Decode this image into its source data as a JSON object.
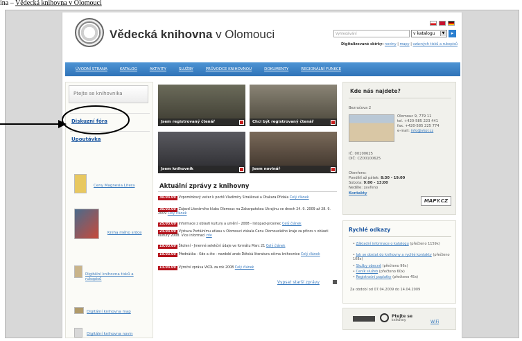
{
  "caption": {
    "text": "ina – Vědecká knihovna v Olomouci",
    "underlined_part": "Vědecká knihovna v Olomouci",
    "prefix": "ina – "
  },
  "header": {
    "site_name_bold": "Vědecká knihovna",
    "site_name_rest": " v Olomouci",
    "search_placeholder": "Vyhledávání",
    "katalog_selected": "v katalogu",
    "go_label": "▸",
    "digi_label": "Digitalizované sbírky:",
    "digi_links": [
      "noviny",
      "mapy",
      "vzácných tisků a rukopisů"
    ]
  },
  "nav": {
    "items": [
      "ÚVODNÍ STRANA",
      "KATALOG",
      "AKTIVITY",
      "SLUŽBY",
      "PRŮVODCE KNIHOVNOU",
      "DOKUMENTY",
      "REGIONÁLNÍ FUNKCE"
    ]
  },
  "left": {
    "ask": "Ptejte se knihovnika",
    "forum": "Diskuzní fóra",
    "upoutavka": "Upoutávka",
    "items": [
      "Ceny Magnesia Litera",
      "Kniha mého srdce",
      "Digitální knihovna tisků a rukopisů",
      "Digitální knihovna map",
      "Digitální knihovna novin"
    ]
  },
  "photos": {
    "p1": "Jsem registrovaný čtenář",
    "p2": "Chci být registrovaný čtenář",
    "p3": "Jsem knihovník",
    "p4": "Jsem novinář"
  },
  "news": {
    "title": "Aktuální zprávy z knihovny",
    "items": [
      {
        "date": "30.03.09",
        "text": "Vzpomínkový večer k poctě Vladimíry Straškové a Otakara Přidala",
        "link": "Celý článek"
      },
      {
        "date": "30.03.09",
        "text": "Zájezd Literárního klubu Olomouc na Zakarpatskou Ukrajinu ve dnech 24. 9. 2009 až 28. 9. 2009",
        "link": "Celý článek"
      },
      {
        "date": "25.03.09",
        "text": "Informace z oblasti kultury a umění - 2008 - listopad-prosinec",
        "link": "Celý článek"
      },
      {
        "date": "23.03.09",
        "text": "Výstava Portálnímu atlasu v Olomouci získala Cenu Olomouckého kraje za přínos v oblasti kultury 2008. Více informací",
        "link": "zde"
      },
      {
        "date": "19.03.09",
        "text": "Školení - Jmenné selekční údaje ve formátu Marc 21",
        "link": "Celý článek"
      },
      {
        "date": "19.03.09",
        "text": "Přednáška - Kdo a čte - nezdobí aneb Dětská literatura očima knihovnice",
        "link": "Celý článek"
      },
      {
        "date": "13.03.09",
        "text": "Výroční zpráva VKOL za rok 2008",
        "link": "Celý článek"
      }
    ],
    "older": "Vypsat starší zprávy"
  },
  "contact": {
    "title": "Kde nás najdete?",
    "street": "Bezručova 2",
    "city": "Olomouc 9, 779 11",
    "tel": "tel. +420-585 223 441",
    "fax": "fax. +420-585 225 774",
    "email_label": "e-mail: ",
    "email": "info@vkol.cz",
    "ic": "IČ: 00100625",
    "dic": "DIČ: CZ00100625",
    "open_label": "Otevřeno:",
    "weekdays_label": "Pondělí až pátek: ",
    "weekdays_hours": "8:30 - 19:00",
    "saturday_label": "Sobota: ",
    "saturday_hours": "9:00 - 13:00",
    "sunday": "Neděle: zavřeno",
    "kontakty": "Kontakty",
    "mapy": "MAPY.CZ"
  },
  "quick": {
    "title": "Rychlé odkazy",
    "items": [
      {
        "link": "Základní informace o katalogu",
        "rest": " (přečteno 1159x)"
      },
      {
        "link": "Jak se dostat do knihovny a rychlé kontakty",
        "rest": " (přečteno 108x)"
      },
      {
        "link": "Služby obecně",
        "rest": " (přečteno 96x)"
      },
      {
        "link": "Ceník služeb",
        "rest": " (přečteno 60x)"
      },
      {
        "link": "Registrační poplatky",
        "rest": " (přečteno 45x)"
      }
    ],
    "footer": "Za období od 07.04.2009 do 14.04.2009"
  },
  "wifi": {
    "ptejte": "Ptejte se",
    "knihovny": "knihovny",
    "wifi": "WiFi"
  },
  "colors": {
    "nav_blue": "#2f73b8",
    "link_blue": "#3a7bbf",
    "date_red": "#b5121b"
  }
}
